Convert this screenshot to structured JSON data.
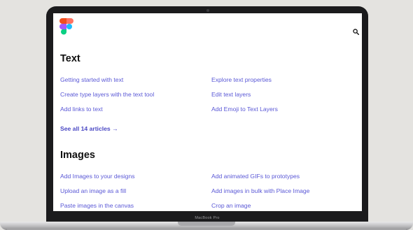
{
  "device": {
    "model_label": "MacBook Pro"
  },
  "header": {
    "logo_icon": "figma-logo",
    "search_icon": "search-icon"
  },
  "colors": {
    "link": "#5a58d6",
    "heading": "#111111",
    "bezel": "#1b1b1d"
  },
  "sections": [
    {
      "title": "Text",
      "links": [
        "Getting started with text",
        "Explore text properties",
        "Create type layers with the text tool",
        "Edit text layers",
        "Add links to text",
        "Add Emoji to Text Layers"
      ],
      "see_all": "See all 14 articles →"
    },
    {
      "title": "Images",
      "links": [
        "Add Images to your designs",
        "Add animated GIFs to prototypes",
        "Upload an image as a fill",
        "Add images in bulk with Place Image",
        "Paste images in the canvas",
        "Crop an image"
      ]
    }
  ]
}
